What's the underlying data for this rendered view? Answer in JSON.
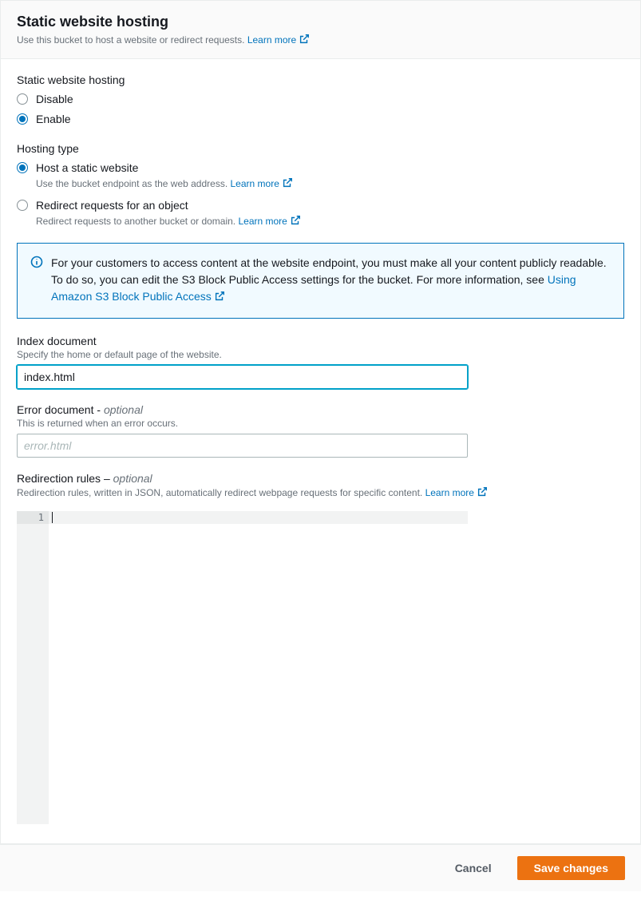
{
  "header": {
    "title": "Static website hosting",
    "subtitle": "Use this bucket to host a website or redirect requests.",
    "learn_more": "Learn more"
  },
  "static_hosting": {
    "label": "Static website hosting",
    "options": {
      "disable": "Disable",
      "enable": "Enable"
    }
  },
  "hosting_type": {
    "label": "Hosting type",
    "options": {
      "static": {
        "label": "Host a static website",
        "desc": "Use the bucket endpoint as the web address.",
        "learn_more": "Learn more"
      },
      "redirect": {
        "label": "Redirect requests for an object",
        "desc": "Redirect requests to another bucket or domain.",
        "learn_more": "Learn more"
      }
    }
  },
  "info_box": {
    "text": "For your customers to access content at the website endpoint, you must make all your content publicly readable. To do so, you can edit the S3 Block Public Access settings for the bucket. For more information, see ",
    "link": "Using Amazon S3 Block Public Access"
  },
  "index_doc": {
    "label": "Index document",
    "desc": "Specify the home or default page of the website.",
    "value": "index.html"
  },
  "error_doc": {
    "label_main": "Error document - ",
    "label_optional": "optional",
    "desc": "This is returned when an error occurs.",
    "placeholder": "error.html",
    "value": ""
  },
  "redirect_rules": {
    "label_main": "Redirection rules – ",
    "label_optional": "optional",
    "desc": "Redirection rules, written in JSON, automatically redirect webpage requests for specific content.",
    "learn_more": "Learn more",
    "line_number": "1"
  },
  "buttons": {
    "cancel": "Cancel",
    "save": "Save changes"
  }
}
